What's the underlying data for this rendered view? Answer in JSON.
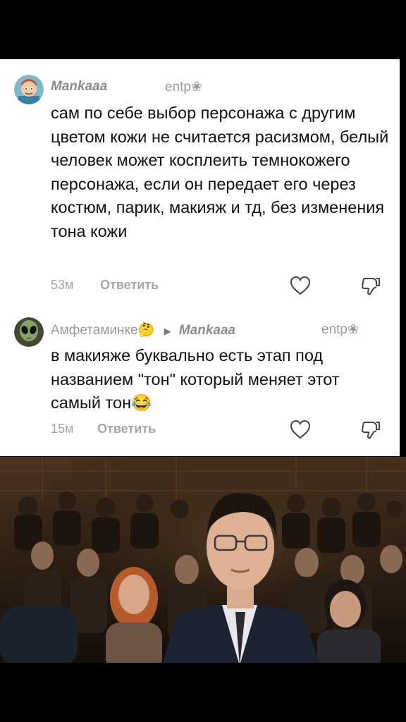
{
  "comments": [
    {
      "author": "Mankaaa",
      "mbti": "entp❀",
      "text": "сам по себе выбор персонажа с другим цветом кожи не считается расизмом, белый человек может косплеить темнокожего персонажа, если он передает его через костюм, парик, макияж и тд, без изменения тона кожи",
      "time": "53м",
      "reply_label": "Ответить",
      "avatar_icon": "cartoon-character-avatar"
    },
    {
      "author": "Амфетаминке🤔",
      "reply_to": "Mankaaa",
      "mbti": "entp❀",
      "text": "в макияже буквально есть этап под названием \"тон\" который меняет этот самый тон😂",
      "time": "15м",
      "reply_label": "Ответить",
      "avatar_icon": "alien-avatar"
    }
  ],
  "icons": {
    "like": "heart-outline-icon",
    "dislike": "thumb-down-outline-icon"
  },
  "colors": {
    "card_bg": "#ffffff",
    "page_bg": "#000000",
    "muted": "#a6a6a6",
    "text": "#111111"
  }
}
